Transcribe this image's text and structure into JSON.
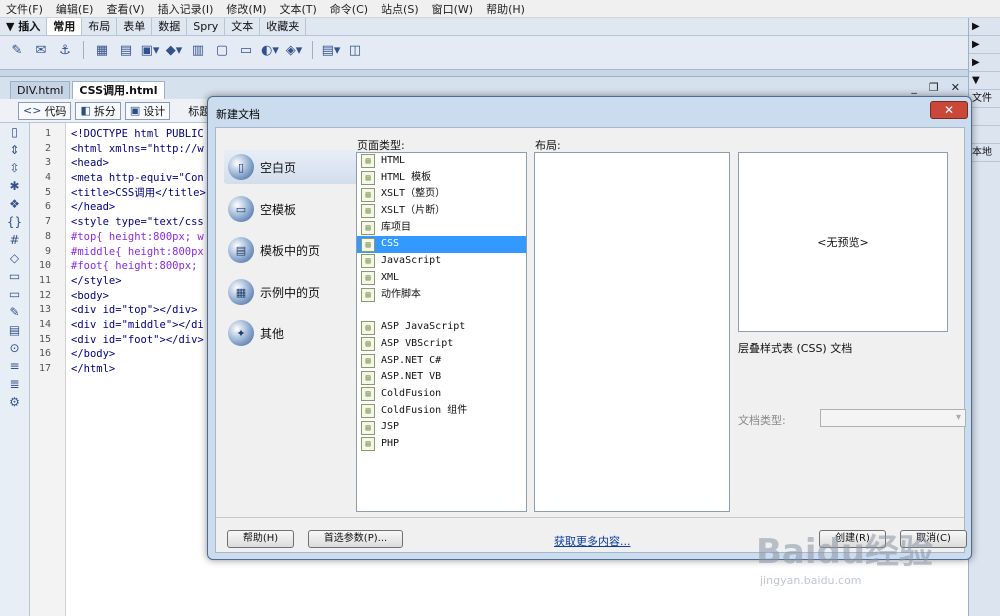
{
  "menubar": [
    "文件(F)",
    "编辑(E)",
    "查看(V)",
    "插入记录(I)",
    "修改(M)",
    "文本(T)",
    "命令(C)",
    "站点(S)",
    "窗口(W)",
    "帮助(H)"
  ],
  "insert_panel": {
    "header": "▼ 插入",
    "tabs": [
      "常用",
      "布局",
      "表单",
      "数据",
      "Spry",
      "文本",
      "收藏夹"
    ],
    "active_tab": "常用"
  },
  "right_panel": [
    "▶",
    "▶",
    "▶",
    "▼",
    "文件",
    "",
    "",
    "本地"
  ],
  "doc": {
    "tabs": [
      "DIV.html",
      "CSS调用.html"
    ],
    "active_tab": "CSS调用.html",
    "window_controls": [
      "_",
      "❐",
      "✕"
    ],
    "view_buttons": [
      "代码",
      "拆分",
      "设计"
    ],
    "title_label": "标题",
    "line_numbers": [
      "1",
      "2",
      "3",
      "4",
      "5",
      "6",
      "7",
      "8",
      "9",
      "10",
      "11",
      "12",
      "13",
      "14",
      "15",
      "16",
      "17"
    ],
    "code_lines": [
      "<!DOCTYPE html PUBLIC",
      "<html xmlns=\"http://w",
      "<head>",
      "<meta http-equiv=\"Con",
      "<title>CSS调用</title>",
      "</head>",
      "<style type=\"text/css",
      "#top{ height:800px; w",
      "#middle{ height:800px",
      "#foot{ height:800px;",
      "</style>",
      "<body>",
      "<div id=\"top\"></div>",
      "<div id=\"middle\"></di",
      "<div id=\"foot\"></div>",
      "</body>",
      "</html>"
    ]
  },
  "dialog": {
    "title": "新建文档",
    "close": "✕",
    "categories": [
      "空白页",
      "空模板",
      "模板中的页",
      "示例中的页",
      "其他"
    ],
    "selected_category": "空白页",
    "page_type_label": "页面类型:",
    "layout_label": "布局:",
    "page_types_a": [
      "HTML",
      "HTML 模板",
      "XSLT（整页）",
      "XSLT（片断）",
      "库项目",
      "CSS",
      "JavaScript",
      "XML",
      "动作脚本"
    ],
    "page_types_b": [
      "ASP JavaScript",
      "ASP VBScript",
      "ASP.NET C#",
      "ASP.NET VB",
      "ColdFusion",
      "ColdFusion 组件",
      "JSP",
      "PHP"
    ],
    "selected_page_type": "CSS",
    "preview_text": "<无预览>",
    "description": "层叠样式表 (CSS) 文档",
    "doctype_label": "文档类型:",
    "buttons": {
      "help": "帮助(H)",
      "prefs": "首选参数(P)...",
      "more": "获取更多内容...",
      "create": "创建(R)",
      "cancel": "取消(C)"
    }
  },
  "watermark": {
    "text": "Baidu经验",
    "sub": "jingyan.baidu.com"
  }
}
